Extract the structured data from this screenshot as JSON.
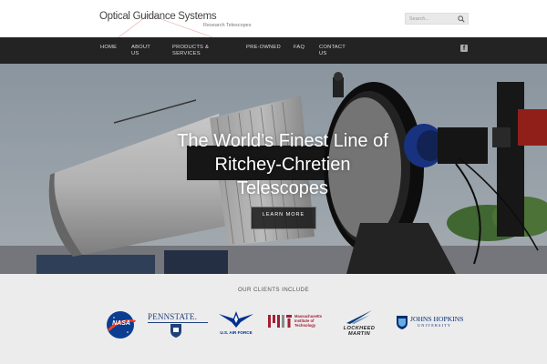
{
  "header": {
    "logo_title": "Optical Guidance Systems",
    "logo_subtitle": "Research Telescopes",
    "search_placeholder": "Search..."
  },
  "nav": {
    "items": [
      {
        "label": "HOME"
      },
      {
        "label": "ABOUT US"
      },
      {
        "label": "PRODUCTS & SERVICES"
      },
      {
        "label": "PRE-OWNED"
      },
      {
        "label": "FAQ"
      },
      {
        "label": "CONTACT US"
      }
    ],
    "social_icon": "facebook-icon"
  },
  "hero": {
    "title_line1": "The World’s Finest Line of",
    "title_line2": "Ritchey-Chretien",
    "title_line3": "Telescopes",
    "button_label": "LEARN MORE"
  },
  "clients": {
    "heading": "OUR CLIENTS INCLUDE",
    "logos": [
      {
        "name": "NASA",
        "text": "NASA"
      },
      {
        "name": "Penn State",
        "text": "PENNSTATE."
      },
      {
        "name": "U.S. Air Force",
        "text": "U.S. AIR FORCE"
      },
      {
        "name": "MIT",
        "text_line1": "Massachusetts",
        "text_line2": "Institute of",
        "text_line3": "Technology"
      },
      {
        "name": "Lockheed Martin",
        "text_line1": "LOCKHEED",
        "text_line2": "MARTIN"
      },
      {
        "name": "Johns Hopkins",
        "text_line1": "JOHNS HOPKINS",
        "text_line2": "UNIVERSITY"
      }
    ]
  },
  "colors": {
    "nav_background": "#232323",
    "clients_background": "#ececec",
    "nasa_blue": "#0b3d91",
    "nasa_red": "#fc3d21",
    "mit_red": "#a31f34",
    "hopkins_blue": "#002d72"
  }
}
